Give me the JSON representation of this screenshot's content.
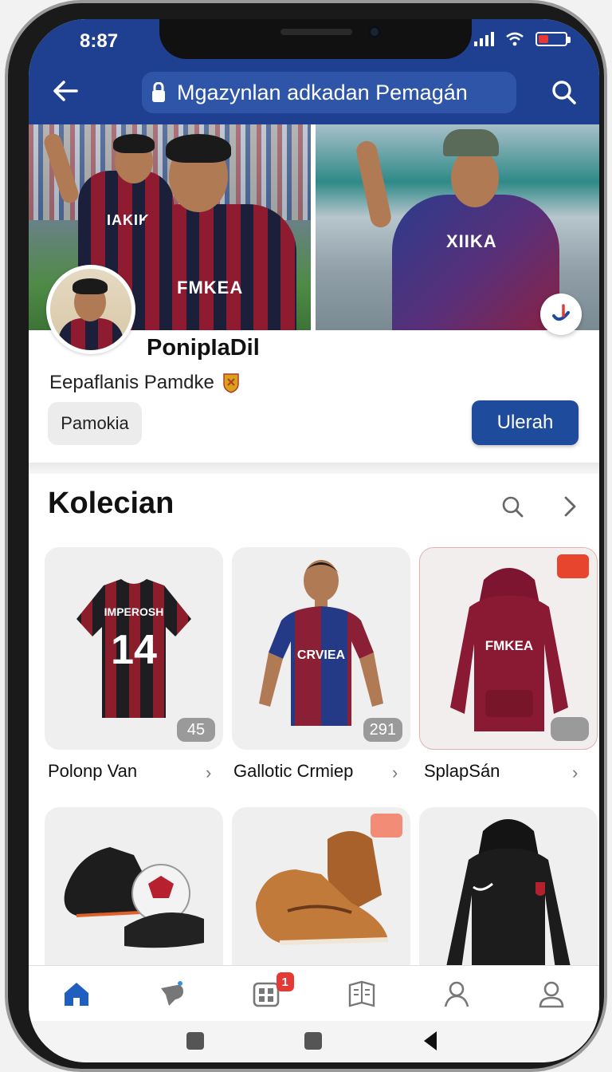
{
  "status": {
    "time": "8:87"
  },
  "header": {
    "search_text": "Mgazynlan adkadan Pemagán"
  },
  "cover": {
    "left_jersey_text": "FMKEA",
    "left_back_jersey_text": "IAKIKE",
    "right_jersey_text": "XIIKA"
  },
  "profile": {
    "name": "PonipIaDil",
    "subtitle": "Eepaflanis Pamdke",
    "chip_label": "Pamokia",
    "action_label": "Ulerah"
  },
  "collection": {
    "title": "Kolecian",
    "items": [
      {
        "label": "Polonp Van",
        "count": "45",
        "print_top": "IMPEROSH",
        "print_num": "14"
      },
      {
        "label": "Gallotic Crmiep",
        "count": "291",
        "print": "CRVIEA"
      },
      {
        "label": "SplapSán",
        "count": "",
        "print": "FMKEA"
      },
      {
        "label": ""
      },
      {
        "label": ""
      },
      {
        "label": ""
      }
    ]
  },
  "tabbar": {
    "badge_count": "1",
    "tabs": [
      "home-icon",
      "whistle-icon",
      "grid-icon",
      "book-icon",
      "profile-icon",
      "account-icon"
    ]
  },
  "colors": {
    "brand": "#1f3f91",
    "accent_red": "#e53935"
  }
}
